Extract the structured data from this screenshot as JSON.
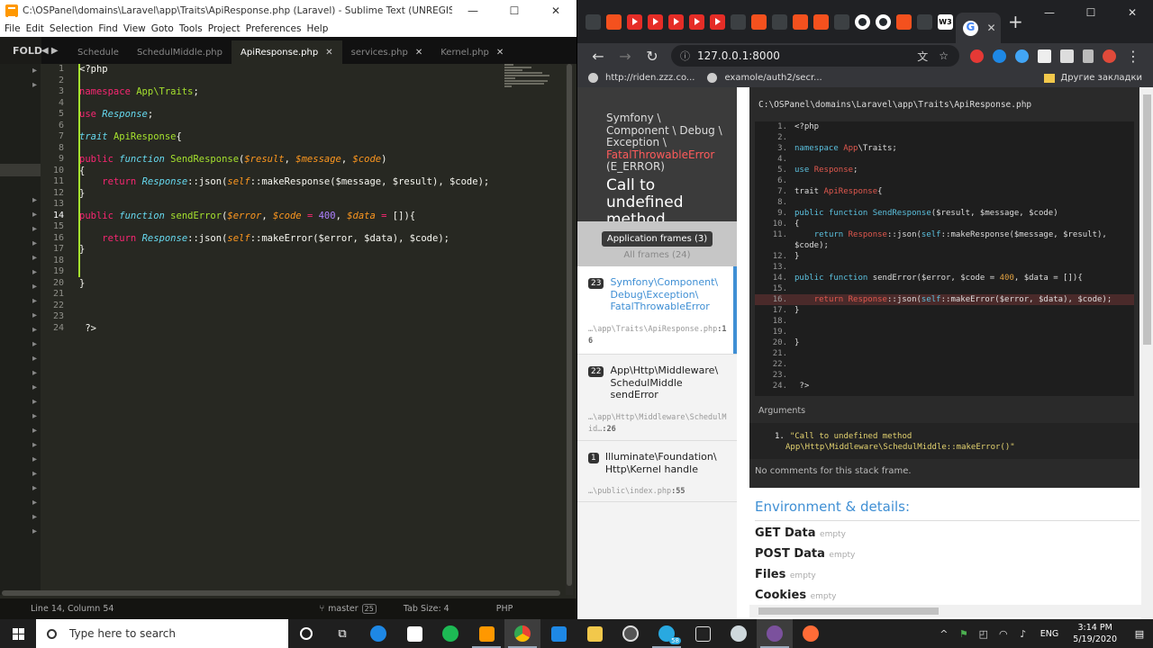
{
  "sublime": {
    "title": "C:\\OSPanel\\domains\\Laravel\\app\\Traits\\ApiResponse.php (Laravel) - Sublime Text (UNREGISTERED)",
    "menu": [
      "File",
      "Edit",
      "Selection",
      "Find",
      "View",
      "Goto",
      "Tools",
      "Project",
      "Preferences",
      "Help"
    ],
    "folders_label": "FOLD",
    "tabs": [
      {
        "label": "Schedule",
        "active": false
      },
      {
        "label": "SchedulMiddle.php",
        "active": false
      },
      {
        "label": "ApiResponse.php",
        "active": true
      },
      {
        "label": "services.php",
        "active": false
      },
      {
        "label": "Kernel.php",
        "active": false
      }
    ],
    "status": {
      "position": "Line 14, Column 54",
      "branch": "master",
      "branch_count": "25",
      "tab_size": "Tab Size: 4",
      "syntax": "PHP"
    }
  },
  "chrome": {
    "url": "127.0.0.1:8000",
    "bookmarks": [
      "http://riden.zzz.co...",
      "examole/auth2/secr..."
    ],
    "other_bookmarks": "Другие закладки"
  },
  "whoops": {
    "exception_lines": [
      "Symfony \\",
      "Component \\ Debug \\",
      "Exception \\"
    ],
    "exception_class": "FatalThrowableError",
    "exception_type": "(E_ERROR)",
    "message": "Call to undefined method",
    "app_frames_btn": "Application frames (3)",
    "all_frames": "All frames (24)",
    "frames": [
      {
        "num": "23",
        "cls": "Symfony\\Component\\ Debug\\Exception\\ FatalThrowableError",
        "file": "…\\app\\Traits\\ApiResponse.php",
        "line": ":16"
      },
      {
        "num": "22",
        "cls": "App\\Http\\Middleware\\ SchedulMiddle sendError",
        "file": "…\\app\\Http\\Middleware\\SchedulMid…",
        "line": ":26"
      },
      {
        "num": "1",
        "cls": "Illuminate\\Foundation\\ Http\\Kernel handle",
        "file": "…\\public\\index.php",
        "line": ":55"
      }
    ],
    "file_path": "C:\\OSPanel\\domains\\Laravel\\app\\Traits\\ApiResponse.php",
    "arguments_label": "Arguments",
    "argument_num": "1.",
    "argument_value": "\"Call to undefined method App\\Http\\Middleware\\SchedulMiddle::makeError()\"",
    "no_comments": "No comments for this stack frame.",
    "env_title": "Environment & details:",
    "env_sections": [
      {
        "name": "GET Data",
        "state": "empty"
      },
      {
        "name": "POST Data",
        "state": "empty"
      },
      {
        "name": "Files",
        "state": "empty"
      },
      {
        "name": "Cookies",
        "state": "empty"
      }
    ]
  },
  "taskbar": {
    "search_placeholder": "Type here to search",
    "language": "ENG",
    "time": "3:14 PM",
    "date": "5/19/2020",
    "badge": "58"
  }
}
